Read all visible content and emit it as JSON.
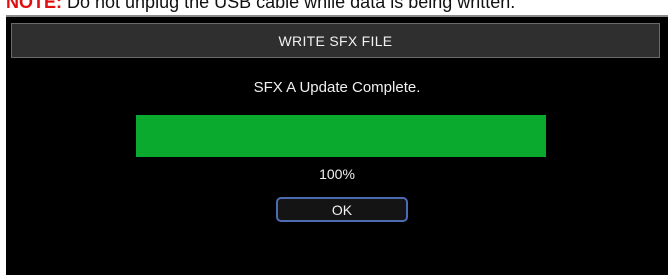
{
  "note": {
    "label": "NOTE:",
    "text": " Do not unplug the USB cable while data is being written."
  },
  "dialog": {
    "title": "WRITE SFX FILE",
    "message": "SFX A Update Complete.",
    "progress": {
      "value": 100,
      "label": "100%",
      "color": "#0aaa2f"
    },
    "ok_label": "OK"
  }
}
